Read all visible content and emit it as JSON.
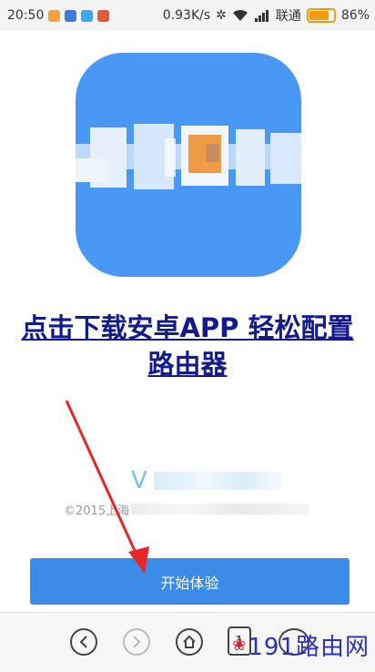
{
  "status_bar": {
    "time": "20:50",
    "speed": "0.93K/s",
    "carrier": "联通",
    "battery": "86%",
    "battery_level": 0.86,
    "accent_battery": "#f39c12"
  },
  "app": {
    "logo_color": "#4a98f5",
    "download_link_lines": [
      "点击下载安卓APP 轻松配置",
      "路由器"
    ]
  },
  "footer": {
    "version_prefix": "V",
    "copyright_prefix": "©2015上海"
  },
  "start_button": {
    "label": "开始体验",
    "color": "#3b8be8"
  },
  "browser_nav": {
    "tab_count": "1",
    "icons": [
      "back-icon",
      "forward-icon",
      "home-icon",
      "tabs-icon",
      "menu-icon"
    ]
  },
  "watermark": {
    "text": "191路由网"
  }
}
